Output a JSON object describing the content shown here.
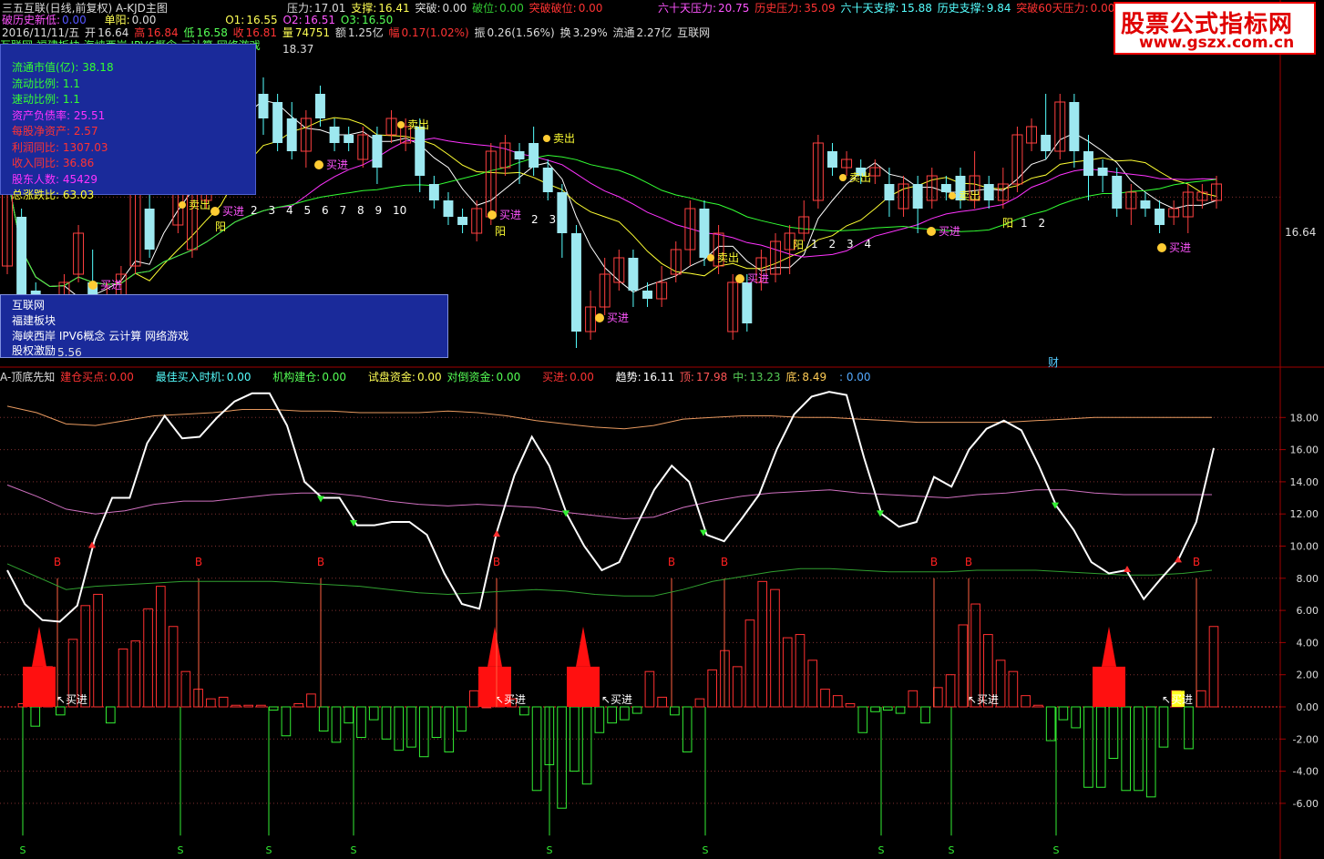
{
  "header": {
    "title": "三五互联(日线,前复权) A-KJD主图",
    "resist_label": "压力:",
    "resist_val": "17.01",
    "support_label": "支撑:",
    "support_val": "16.41",
    "break_label": "突破:",
    "break_val": "0.00",
    "breakpos_label": "破位:",
    "breakpos_val": "0.00",
    "breakbreak_label": "突破破位:",
    "breakbreak_val": "0.00",
    "d60r_label": "六十天压力:",
    "d60r_val": "20.75",
    "histr_label": "历史压力:",
    "histr_val": "35.09",
    "d60s_label": "六十天支撑:",
    "d60s_val": "15.88",
    "hists_label": "历史支撑:",
    "hists_val": "9.84",
    "b60_label": "突破60天压力:",
    "b60_val": "0.00",
    "tail": "突破",
    "hlow_label": "破历史新低:",
    "hlow_val": "0.00",
    "yang_label": "单阳:",
    "yang_val": "0.00",
    "o1_label": "O1:",
    "o1_val": "16.55",
    "o2_label": "O2:",
    "o2_val": "16.51",
    "o3_label": "O3:",
    "o3_val": "16.50",
    "date": "2016/11/11/五",
    "open_label": "开",
    "open_val": "16.64",
    "high_label": "高",
    "high_val": "16.84",
    "low_label": "低",
    "low_val": "16.58",
    "close_label": "收",
    "close_val": "16.81",
    "vol_label": "量",
    "vol_val": "74751",
    "amt_label": "额",
    "amt_val": "1.25亿",
    "chg_label": "幅",
    "chg_val": "0.17(1.02%)",
    "amp_label": "振",
    "amp_val": "0.26(1.56%)",
    "turn_label": "换",
    "turn_val": "3.29%",
    "float_label": "流通",
    "float_val": "2.27亿",
    "sector": "互联网"
  },
  "concept_line": "互联网 福建板块 海峡西岸 IPV6概念 云计算 网络游戏",
  "price_high_label": "18.37",
  "price_axis_label": "16.64",
  "info": [
    {
      "text": "流通市值(亿): 38.18",
      "color": "#33ff33"
    },
    {
      "text": "流动比例: 1.1",
      "color": "#33ff33"
    },
    {
      "text": "速动比例: 1.1",
      "color": "#33ff33"
    },
    {
      "text": "资产负债率: 25.51",
      "color": "#ff33ff"
    },
    {
      "text": "每股净资产: 2.57",
      "color": "#ff3333"
    },
    {
      "text": "利润同比: 1307.03",
      "color": "#ff3333"
    },
    {
      "text": "收入同比: 36.86",
      "color": "#ff3333"
    },
    {
      "text": "股东人数: 45429",
      "color": "#ff33ff"
    },
    {
      "text": "总涨跌比: 63.03",
      "color": "#ffff33"
    }
  ],
  "concept_box": [
    "互联网",
    "福建板块",
    "海峡西岸 IPV6概念 云计算 网络游戏",
    "股权激励"
  ],
  "concept_extra": "5.56",
  "cai_label": "财",
  "indicator": {
    "name": "A-顶底先知",
    "build_label": "建仓买点:",
    "build_val": "0.00",
    "best_label": "最佳买入时机:",
    "best_val": "0.00",
    "inst_label": "机构建仓:",
    "inst_val": "0.00",
    "test_label": "试盘资金:",
    "test_val": "0.00",
    "hedge_label": "对倒资金:",
    "hedge_val": "0.00",
    "buy_label": "买进:",
    "buy_val": "0.00",
    "trend_label": "趋势:",
    "trend_val": "16.11",
    "top_label": "顶:",
    "top_val": "17.98",
    "mid_label": "中:",
    "mid_val": "13.23",
    "bot_label": "底:",
    "bot_val": "8.49",
    "tail": ": 0.00"
  },
  "labels": {
    "sell": "卖出",
    "buy": "买进",
    "yang": "阳",
    "b_mark": "B",
    "s_mark": "S"
  },
  "counts": {
    "run1": [
      "2",
      "3",
      "4",
      "5",
      "6",
      "7",
      "8",
      "9",
      "10"
    ],
    "run2": [
      "2",
      "3"
    ],
    "run3": [
      "1",
      "2",
      "3",
      "4"
    ],
    "run4": [
      "1",
      "2"
    ]
  },
  "y_axis": [
    "18.00",
    "16.00",
    "14.00",
    "12.00",
    "10.00",
    "8.00",
    "6.00",
    "4.00",
    "2.00",
    "0.00",
    "-2.00",
    "-4.00",
    "-6.00"
  ],
  "logo": {
    "line1": "股票公式指标网",
    "line2": "www.gszx.com.cn"
  },
  "chart_data": {
    "type": "mixed",
    "candles": [
      {
        "o": 15.8,
        "c": 16.9,
        "h": 17.0,
        "l": 15.7
      },
      {
        "o": 16.4,
        "c": 15.1,
        "h": 16.5,
        "l": 15.0
      },
      {
        "o": 15.5,
        "c": 15.0,
        "h": 15.6,
        "l": 14.8
      },
      {
        "o": 15.0,
        "c": 15.2,
        "h": 15.4,
        "l": 14.9
      },
      {
        "o": 15.3,
        "c": 15.6,
        "h": 15.7,
        "l": 15.2
      },
      {
        "o": 15.7,
        "c": 16.2,
        "h": 16.3,
        "l": 15.6
      },
      {
        "o": 15.6,
        "c": 15.2,
        "h": 16.0,
        "l": 15.0
      },
      {
        "o": 15.2,
        "c": 15.4,
        "h": 15.6,
        "l": 15.1
      },
      {
        "o": 15.4,
        "c": 15.7,
        "h": 15.8,
        "l": 15.3
      },
      {
        "o": 15.8,
        "c": 16.8,
        "h": 16.9,
        "l": 15.7
      },
      {
        "o": 16.5,
        "c": 16.0,
        "h": 16.7,
        "l": 15.9
      },
      {
        "o": 16.9,
        "c": 17.1,
        "h": 17.2,
        "l": 16.8
      },
      {
        "o": 16.3,
        "c": 16.8,
        "h": 16.9,
        "l": 16.2
      },
      {
        "o": 16.0,
        "c": 16.9,
        "h": 17.0,
        "l": 15.9
      },
      {
        "o": 16.6,
        "c": 17.5,
        "h": 17.6,
        "l": 16.5
      },
      {
        "o": 17.2,
        "c": 18.0,
        "h": 18.2,
        "l": 17.1
      },
      {
        "o": 17.6,
        "c": 18.3,
        "h": 18.37,
        "l": 17.4
      },
      {
        "o": 18.0,
        "c": 17.7,
        "h": 18.2,
        "l": 17.5
      },
      {
        "o": 17.9,
        "c": 17.6,
        "h": 18.1,
        "l": 17.4
      },
      {
        "o": 17.8,
        "c": 17.3,
        "h": 17.9,
        "l": 17.2
      },
      {
        "o": 17.6,
        "c": 17.2,
        "h": 17.8,
        "l": 17.1
      },
      {
        "o": 17.2,
        "c": 17.6,
        "h": 17.7,
        "l": 17.0
      },
      {
        "o": 17.9,
        "c": 17.6,
        "h": 18.0,
        "l": 17.5
      },
      {
        "o": 17.5,
        "c": 17.3,
        "h": 17.6,
        "l": 17.2
      },
      {
        "o": 17.4,
        "c": 17.3,
        "h": 17.5,
        "l": 17.2
      },
      {
        "o": 17.1,
        "c": 17.4,
        "h": 17.5,
        "l": 17.0
      },
      {
        "o": 17.4,
        "c": 17.0,
        "h": 17.5,
        "l": 16.8
      },
      {
        "o": 17.4,
        "c": 17.6,
        "h": 17.7,
        "l": 17.3
      },
      {
        "o": 17.3,
        "c": 17.5,
        "h": 17.6,
        "l": 17.2
      },
      {
        "o": 17.5,
        "c": 16.9,
        "h": 17.6,
        "l": 16.7
      },
      {
        "o": 16.8,
        "c": 16.6,
        "h": 16.9,
        "l": 16.5
      },
      {
        "o": 16.6,
        "c": 16.4,
        "h": 16.7,
        "l": 16.3
      },
      {
        "o": 16.4,
        "c": 16.3,
        "h": 16.5,
        "l": 16.2
      },
      {
        "o": 16.2,
        "c": 16.5,
        "h": 16.6,
        "l": 16.1
      },
      {
        "o": 16.4,
        "c": 17.2,
        "h": 17.3,
        "l": 16.3
      },
      {
        "o": 17.0,
        "c": 17.3,
        "h": 17.4,
        "l": 16.9
      },
      {
        "o": 17.2,
        "c": 17.1,
        "h": 17.3,
        "l": 16.8
      },
      {
        "o": 17.3,
        "c": 17.0,
        "h": 17.5,
        "l": 16.9
      },
      {
        "o": 17.0,
        "c": 16.7,
        "h": 17.1,
        "l": 16.6
      },
      {
        "o": 16.7,
        "c": 16.2,
        "h": 16.8,
        "l": 15.9
      },
      {
        "o": 16.2,
        "c": 15.0,
        "h": 16.3,
        "l": 14.8
      },
      {
        "o": 15.0,
        "c": 15.3,
        "h": 15.5,
        "l": 14.9
      },
      {
        "o": 15.3,
        "c": 15.7,
        "h": 15.9,
        "l": 15.2
      },
      {
        "o": 15.6,
        "c": 15.9,
        "h": 16.0,
        "l": 15.5
      },
      {
        "o": 15.9,
        "c": 15.5,
        "h": 16.0,
        "l": 15.3
      },
      {
        "o": 15.5,
        "c": 15.4,
        "h": 15.6,
        "l": 15.3
      },
      {
        "o": 15.4,
        "c": 15.6,
        "h": 15.8,
        "l": 15.3
      },
      {
        "o": 15.7,
        "c": 16.0,
        "h": 16.1,
        "l": 15.6
      },
      {
        "o": 16.0,
        "c": 16.5,
        "h": 16.6,
        "l": 15.8
      },
      {
        "o": 16.5,
        "c": 15.9,
        "h": 16.6,
        "l": 15.8
      },
      {
        "o": 15.8,
        "c": 16.2,
        "h": 16.3,
        "l": 15.7
      },
      {
        "o": 15.0,
        "c": 15.6,
        "h": 15.7,
        "l": 14.9
      },
      {
        "o": 15.6,
        "c": 15.1,
        "h": 15.7,
        "l": 15.0
      },
      {
        "o": 15.6,
        "c": 15.9,
        "h": 16.0,
        "l": 15.5
      },
      {
        "o": 15.7,
        "c": 16.1,
        "h": 16.2,
        "l": 15.6
      },
      {
        "o": 16.0,
        "c": 16.2,
        "h": 16.3,
        "l": 15.7
      },
      {
        "o": 16.2,
        "c": 16.4,
        "h": 16.6,
        "l": 16.1
      },
      {
        "o": 16.6,
        "c": 17.3,
        "h": 17.4,
        "l": 16.5
      },
      {
        "o": 17.2,
        "c": 17.0,
        "h": 17.3,
        "l": 16.9
      },
      {
        "o": 17.0,
        "c": 17.1,
        "h": 17.2,
        "l": 16.9
      },
      {
        "o": 17.0,
        "c": 16.9,
        "h": 17.1,
        "l": 16.8
      },
      {
        "o": 16.9,
        "c": 17.0,
        "h": 17.1,
        "l": 16.8
      },
      {
        "o": 16.8,
        "c": 16.6,
        "h": 17.0,
        "l": 16.4
      },
      {
        "o": 16.5,
        "c": 16.8,
        "h": 16.9,
        "l": 16.4
      },
      {
        "o": 16.8,
        "c": 16.5,
        "h": 16.9,
        "l": 16.2
      },
      {
        "o": 16.6,
        "c": 16.9,
        "h": 17.0,
        "l": 16.5
      },
      {
        "o": 16.8,
        "c": 16.7,
        "h": 16.9,
        "l": 16.6
      },
      {
        "o": 16.9,
        "c": 16.6,
        "h": 17.0,
        "l": 16.5
      },
      {
        "o": 16.6,
        "c": 16.9,
        "h": 17.2,
        "l": 16.5
      },
      {
        "o": 16.8,
        "c": 16.6,
        "h": 16.9,
        "l": 16.5
      },
      {
        "o": 16.6,
        "c": 16.8,
        "h": 17.0,
        "l": 16.5
      },
      {
        "o": 16.8,
        "c": 17.4,
        "h": 17.5,
        "l": 16.7
      },
      {
        "o": 17.3,
        "c": 17.5,
        "h": 17.6,
        "l": 17.2
      },
      {
        "o": 17.4,
        "c": 17.2,
        "h": 17.9,
        "l": 17.1
      },
      {
        "o": 17.2,
        "c": 17.8,
        "h": 17.9,
        "l": 17.1
      },
      {
        "o": 17.8,
        "c": 17.2,
        "h": 17.9,
        "l": 17.0
      },
      {
        "o": 17.2,
        "c": 16.9,
        "h": 17.4,
        "l": 16.6
      },
      {
        "o": 17.0,
        "c": 16.9,
        "h": 17.1,
        "l": 16.7
      },
      {
        "o": 16.9,
        "c": 16.5,
        "h": 17.0,
        "l": 16.4
      },
      {
        "o": 16.5,
        "c": 16.7,
        "h": 16.8,
        "l": 16.3
      },
      {
        "o": 16.6,
        "c": 16.5,
        "h": 16.7,
        "l": 16.4
      },
      {
        "o": 16.5,
        "c": 16.3,
        "h": 16.6,
        "l": 16.2
      },
      {
        "o": 16.4,
        "c": 16.5,
        "h": 16.6,
        "l": 16.3
      },
      {
        "o": 16.4,
        "c": 16.7,
        "h": 16.8,
        "l": 16.2
      },
      {
        "o": 16.6,
        "c": 16.7,
        "h": 16.8,
        "l": 16.5
      },
      {
        "o": 16.6,
        "c": 16.8,
        "h": 16.9,
        "l": 16.5
      }
    ],
    "trend_line": [
      8.5,
      6.4,
      5.4,
      5.3,
      6.3,
      10.4,
      13.0,
      13.0,
      16.4,
      18.1,
      16.7,
      16.8,
      18.0,
      19.0,
      19.5,
      19.5,
      17.5,
      14.0,
      13.0,
      13.0,
      11.3,
      11.3,
      11.5,
      11.5,
      10.7,
      8.3,
      6.4,
      6.1,
      10.9,
      14.4,
      16.8,
      15.0,
      12.0,
      10.0,
      8.5,
      9.0,
      11.3,
      13.5,
      15.0,
      14.0,
      10.7,
      10.3,
      11.7,
      13.2,
      16.0,
      18.2,
      19.3,
      19.6,
      19.4,
      15.5,
      12.0,
      11.2,
      11.5,
      14.3,
      13.7,
      16.0,
      17.3,
      17.8,
      17.2,
      15.0,
      12.5,
      11.0,
      9.0,
      8.3,
      8.5,
      6.7,
      8.0,
      9.2,
      11.5,
      16.1
    ],
    "top_line": [
      18.7,
      18.3,
      17.6,
      17.5,
      17.8,
      18.1,
      18.2,
      18.3,
      18.5,
      18.5,
      18.4,
      18.4,
      18.3,
      18.3,
      18.3,
      18.4,
      18.3,
      18.1,
      17.8,
      17.6,
      17.4,
      17.3,
      17.5,
      17.9,
      18.0,
      18.1,
      18.1,
      18.0,
      18.0,
      17.9,
      17.8,
      17.7,
      17.7,
      17.7,
      17.7,
      17.8,
      17.9,
      18.0,
      18.0,
      18.0,
      18.0,
      18.0
    ],
    "mid_line": [
      13.8,
      13.1,
      12.3,
      12.0,
      12.2,
      12.6,
      12.8,
      12.8,
      13.0,
      13.2,
      13.3,
      13.3,
      13.1,
      12.8,
      12.6,
      12.5,
      12.6,
      12.5,
      12.4,
      12.1,
      11.9,
      11.7,
      11.8,
      12.4,
      12.8,
      13.1,
      13.3,
      13.4,
      13.5,
      13.3,
      13.2,
      13.1,
      13.0,
      13.2,
      13.3,
      13.5,
      13.5,
      13.3,
      13.2,
      13.2,
      13.2,
      13.2
    ],
    "bot_line": [
      8.9,
      8.1,
      7.3,
      7.5,
      7.6,
      7.7,
      7.8,
      7.8,
      7.8,
      7.8,
      7.7,
      7.6,
      7.5,
      7.3,
      7.1,
      7.0,
      7.1,
      7.2,
      7.3,
      7.2,
      7.0,
      6.9,
      6.9,
      7.3,
      7.8,
      8.1,
      8.4,
      8.6,
      8.6,
      8.5,
      8.4,
      8.4,
      8.4,
      8.5,
      8.5,
      8.5,
      8.4,
      8.3,
      8.2,
      8.2,
      8.3,
      8.5
    ],
    "hist": [
      0.2,
      -1.2,
      2.5,
      -0.5,
      4.2,
      6.3,
      7.0,
      -1.0,
      3.6,
      4.1,
      6.1,
      7.5,
      5.0,
      2.2,
      1.1,
      0.5,
      0.6,
      0.1,
      0.1,
      0.1,
      -0.2,
      -1.8,
      0.2,
      0.8,
      -1.5,
      -2.2,
      -1.0,
      -1.9,
      -0.8,
      -2.0,
      -2.7,
      -2.5,
      -3.1,
      -1.9,
      -2.8,
      -1.5,
      1.0,
      0.0,
      2.0,
      0.5,
      -0.5,
      -5.2,
      -3.6,
      -6.3,
      -4.0,
      -4.8,
      -1.6,
      -1.0,
      -0.8,
      -0.4,
      2.2,
      0.6,
      -0.5,
      -2.8,
      0.5,
      2.3,
      3.5,
      2.5,
      5.4,
      7.8,
      7.3,
      4.3,
      4.5,
      2.9,
      1.1,
      0.7,
      0.2,
      -1.6,
      -0.3,
      -0.2,
      -0.4,
      1.0,
      -1.0,
      1.2,
      2.0,
      5.1,
      6.4,
      4.5,
      2.9,
      2.2,
      0.7,
      0.1,
      -2.1,
      -0.8,
      -1.3,
      -5.0,
      -5.0,
      -3.2,
      -5.2,
      -5.2,
      -5.6,
      -2.5,
      1.0,
      -2.6,
      1.0,
      5.0
    ],
    "b_signals": [
      3,
      11,
      18,
      28,
      38,
      41,
      53,
      55
    ],
    "s_signals": [
      1,
      10,
      15,
      20,
      31,
      40,
      50,
      54,
      60
    ]
  }
}
